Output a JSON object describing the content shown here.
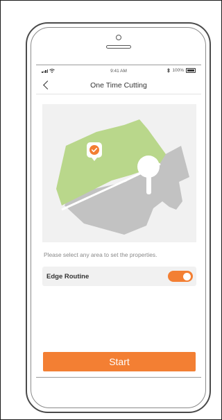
{
  "statusbar": {
    "time": "9:41 AM",
    "battery_text": "100%",
    "icons": [
      "signal-icon",
      "wifi-icon",
      "bluetooth-icon",
      "battery-icon"
    ]
  },
  "nav": {
    "title": "One Time Cutting",
    "back_icon": "chevron-left-icon"
  },
  "map": {
    "selected_icon": "check-marker-icon",
    "colors": {
      "background": "#f1f1f1",
      "selected_area": "#b9d78b",
      "unselected_area": "#c2c2c2",
      "marker": "#f37f33"
    }
  },
  "hint": "Please select any area to set the properties.",
  "settings": {
    "edge_routine_label": "Edge Routine",
    "edge_routine_on": true
  },
  "start_label": "Start",
  "colors": {
    "accent": "#f37f33"
  }
}
